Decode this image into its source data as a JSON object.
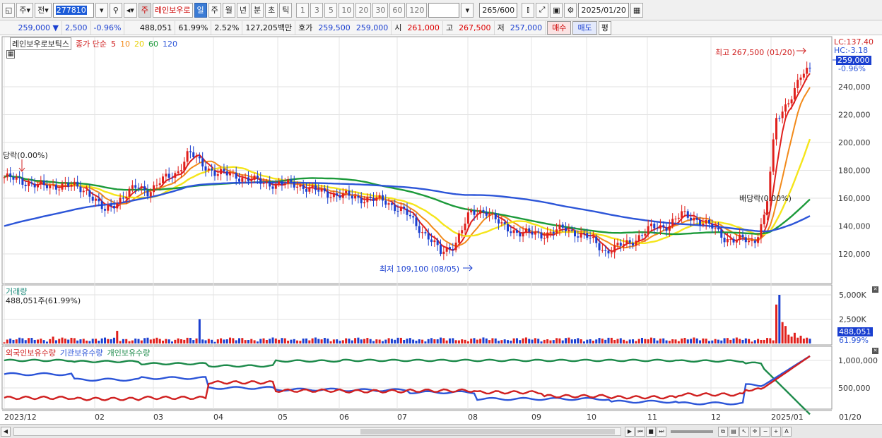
{
  "toolbar": {
    "mode_label": "주",
    "prev_label": "전",
    "code": "277810",
    "stock_badge": "주",
    "stock_name": "레인보우로",
    "periods": [
      "일",
      "주",
      "월",
      "년",
      "분",
      "초",
      "틱"
    ],
    "selected_period": "일",
    "intervals": [
      "1",
      "3",
      "5",
      "10",
      "20",
      "30",
      "60",
      "120"
    ],
    "count": "265",
    "count_max": "/600",
    "date": "2025/01/20"
  },
  "quote": {
    "price": "259,000",
    "change": "2,500",
    "change_pct": "-0.96%",
    "volume": "488,051",
    "vol_ratio": "61.99%",
    "turnover": "2.52%",
    "amount": "127,205백만",
    "bid_label": "호가",
    "ask": "259,500",
    "bid": "259,000",
    "open_label": "시",
    "open": "261,000",
    "high_label": "고",
    "high": "267,500",
    "low_label": "저",
    "low": "257,000",
    "buy_label": "매수",
    "sell_label": "매도",
    "eval_label": "평"
  },
  "price_panel": {
    "name": "레인보우로보틱스",
    "ma_label": "종가 단순",
    "ma_periods": [
      "5",
      "10",
      "20",
      "60",
      "120"
    ],
    "ma_colors": [
      "#e0201c",
      "#f28a1a",
      "#f5e51a",
      "#1c9a3a",
      "#2c55d8"
    ],
    "lc": "LC:137.40",
    "hc": "HC:-3.18",
    "current_price": "259,000",
    "current_pct": "-0.96%",
    "max_note": "최고 267,500 (01/20)",
    "min_note": "최저 109,100 (08/05)",
    "dividend_note": "당락(0.00%)",
    "dividend_note2": "배당락(0.00%)",
    "y_ticks": [
      "240,000",
      "220,000",
      "200,000",
      "180,000",
      "160,000",
      "140,000",
      "120,000"
    ]
  },
  "volume_panel": {
    "title": "거래량",
    "info": "488,051주(61.99%)",
    "y_ticks": [
      "5,000K",
      "2,500K"
    ],
    "current": "488,051",
    "current_pct": "61.99%"
  },
  "holdings_panel": {
    "series": [
      {
        "name": "외국인보유수량",
        "color": "#d02020"
      },
      {
        "name": "기관보유수량",
        "color": "#2c55d8"
      },
      {
        "name": "개인보유수량",
        "color": "#1c8a4a"
      }
    ],
    "y_ticks": [
      "1,000,000",
      "500,000"
    ]
  },
  "x_axis": [
    "2023/12",
    "02",
    "03",
    "04",
    "05",
    "06",
    "07",
    "08",
    "09",
    "10",
    "11",
    "12",
    "2025/01",
    "01/20"
  ]
}
